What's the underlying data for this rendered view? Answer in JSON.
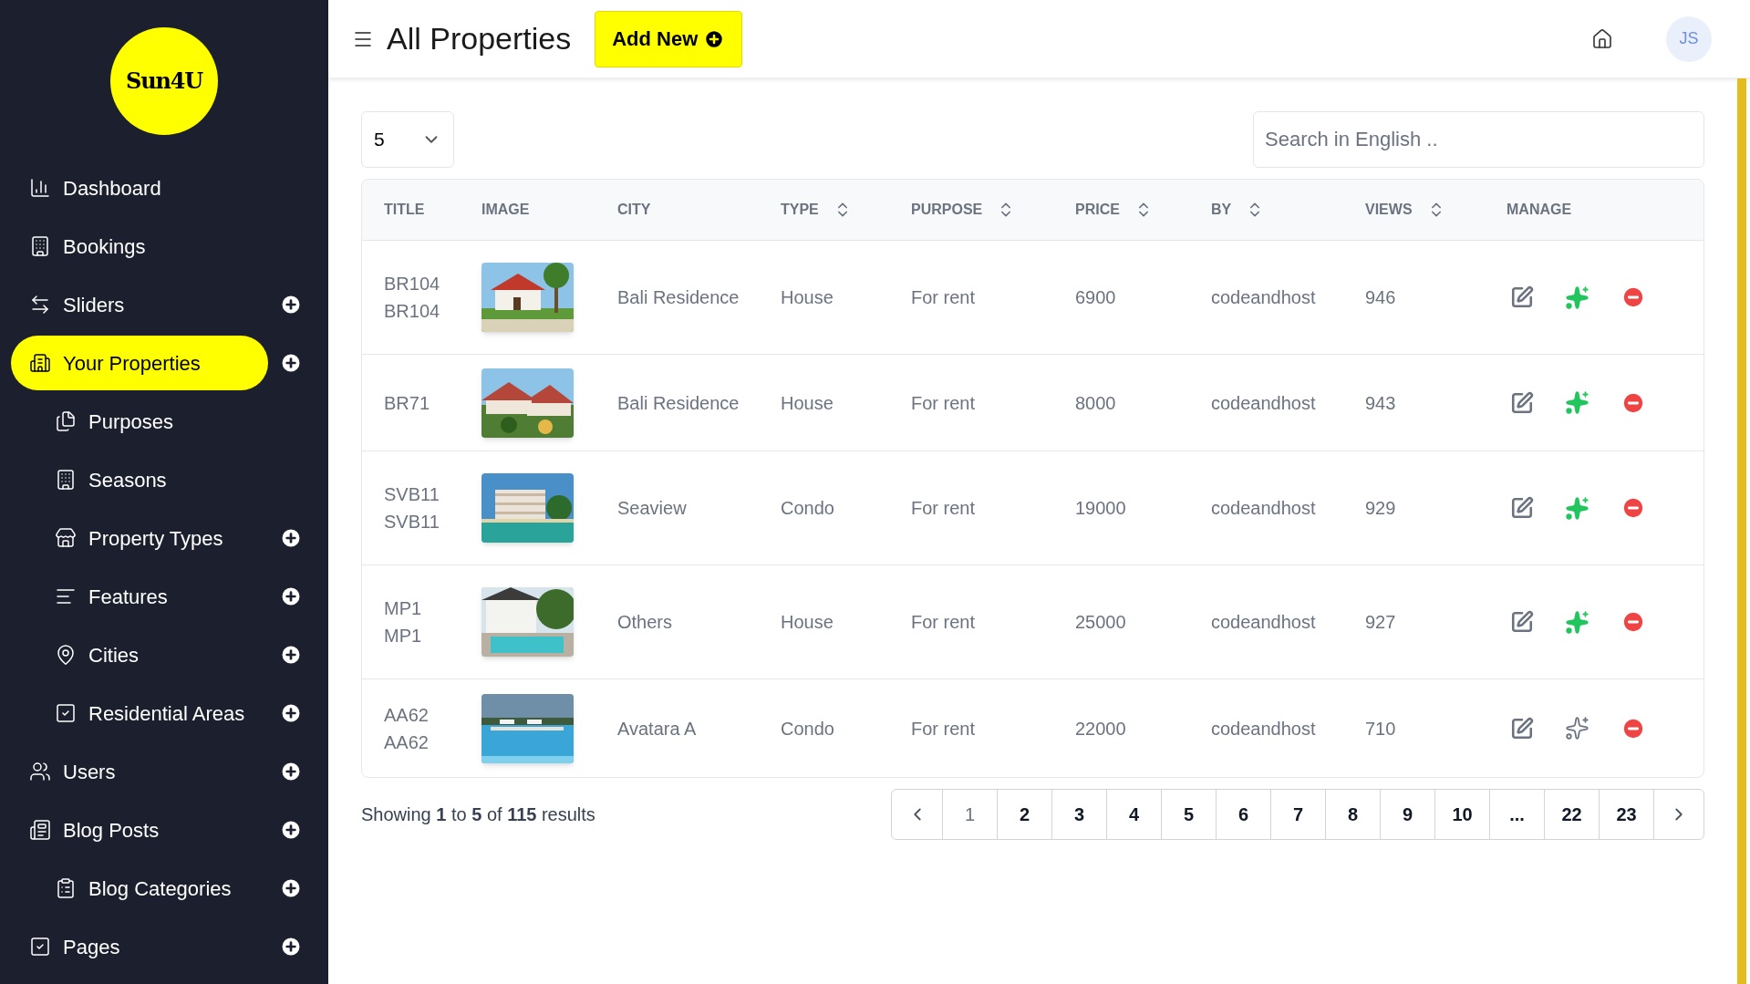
{
  "sidebar": {
    "logo": "Sun4U",
    "items": [
      {
        "label": "Dashboard",
        "selected": false,
        "addable": false
      },
      {
        "label": "Bookings",
        "selected": false,
        "addable": false
      },
      {
        "label": "Sliders",
        "selected": false,
        "addable": true
      },
      {
        "label": "Your Properties",
        "selected": true,
        "addable": true,
        "children": [
          {
            "label": "Purposes",
            "selected": false,
            "addable": false
          },
          {
            "label": "Seasons",
            "selected": false,
            "addable": false
          },
          {
            "label": "Property Types",
            "selected": false,
            "addable": true
          },
          {
            "label": "Features",
            "selected": false,
            "addable": true
          },
          {
            "label": "Cities",
            "selected": false,
            "addable": true
          },
          {
            "label": "Residential Areas",
            "selected": false,
            "addable": true
          }
        ]
      },
      {
        "label": "Users",
        "selected": false,
        "addable": true
      },
      {
        "label": "Blog Posts",
        "selected": false,
        "addable": true,
        "children": [
          {
            "label": "Blog Categories",
            "selected": false,
            "addable": true
          }
        ]
      },
      {
        "label": "Pages",
        "selected": false,
        "addable": true
      }
    ]
  },
  "header": {
    "title": "All Properties",
    "add_button": "Add New",
    "avatar": "JS"
  },
  "page_size": "5",
  "search": {
    "placeholder": "Search in English .."
  },
  "table": {
    "columns": [
      {
        "label": "TITLE",
        "sortable": false
      },
      {
        "label": "IMAGE",
        "sortable": false
      },
      {
        "label": "CITY",
        "sortable": false
      },
      {
        "label": "TYPE",
        "sortable": true
      },
      {
        "label": "PURPOSE",
        "sortable": true
      },
      {
        "label": "PRICE",
        "sortable": true
      },
      {
        "label": "BY",
        "sortable": true
      },
      {
        "label": "VIEWS",
        "sortable": true
      },
      {
        "label": "MANAGE",
        "sortable": false
      }
    ],
    "rows": [
      {
        "title": [
          "BR104",
          "BR104"
        ],
        "image": {
          "kind": "picture"
        },
        "city": "Bali Residence",
        "type": "House",
        "purpose": "For rent",
        "price": "6900",
        "by": "codeandhost",
        "views": "946",
        "featured": true
      },
      {
        "title": [
          "BR71"
        ],
        "image": {
          "kind": "picture"
        },
        "city": "Bali Residence",
        "type": "House",
        "purpose": "For rent",
        "price": "8000",
        "by": "codeandhost",
        "views": "943",
        "featured": true
      },
      {
        "title": [
          "SVB11",
          "SVB11"
        ],
        "image": {
          "kind": "picture"
        },
        "city": "Seaview",
        "type": "Condo",
        "purpose": "For rent",
        "price": "19000",
        "by": "codeandhost",
        "views": "929",
        "featured": true
      },
      {
        "title": [
          "MP1",
          "MP1"
        ],
        "image": {
          "kind": "picture"
        },
        "city": "Others",
        "type": "House",
        "purpose": "For rent",
        "price": "25000",
        "by": "codeandhost",
        "views": "927",
        "featured": true
      },
      {
        "title": [
          "AA62",
          "AA62"
        ],
        "image": {
          "kind": "picture"
        },
        "city": "Avatara A",
        "type": "Condo",
        "purpose": "For rent",
        "price": "22000",
        "by": "codeandhost",
        "views": "710",
        "featured": false
      }
    ]
  },
  "summary": "Showing **1** to **5** of **115** results",
  "pagination": [
    {
      "label": "1",
      "selected": true
    },
    {
      "label": "2",
      "selected": false
    },
    {
      "label": "3",
      "selected": false
    },
    {
      "label": "4",
      "selected": false
    },
    {
      "label": "5",
      "selected": false
    },
    {
      "label": "6",
      "selected": false
    },
    {
      "label": "7",
      "selected": false
    },
    {
      "label": "8",
      "selected": false
    },
    {
      "label": "9",
      "selected": false
    },
    {
      "label": "10",
      "selected": false
    },
    {
      "label": "...",
      "selected": false
    },
    {
      "label": "22",
      "selected": false
    },
    {
      "label": "23",
      "selected": false
    }
  ]
}
